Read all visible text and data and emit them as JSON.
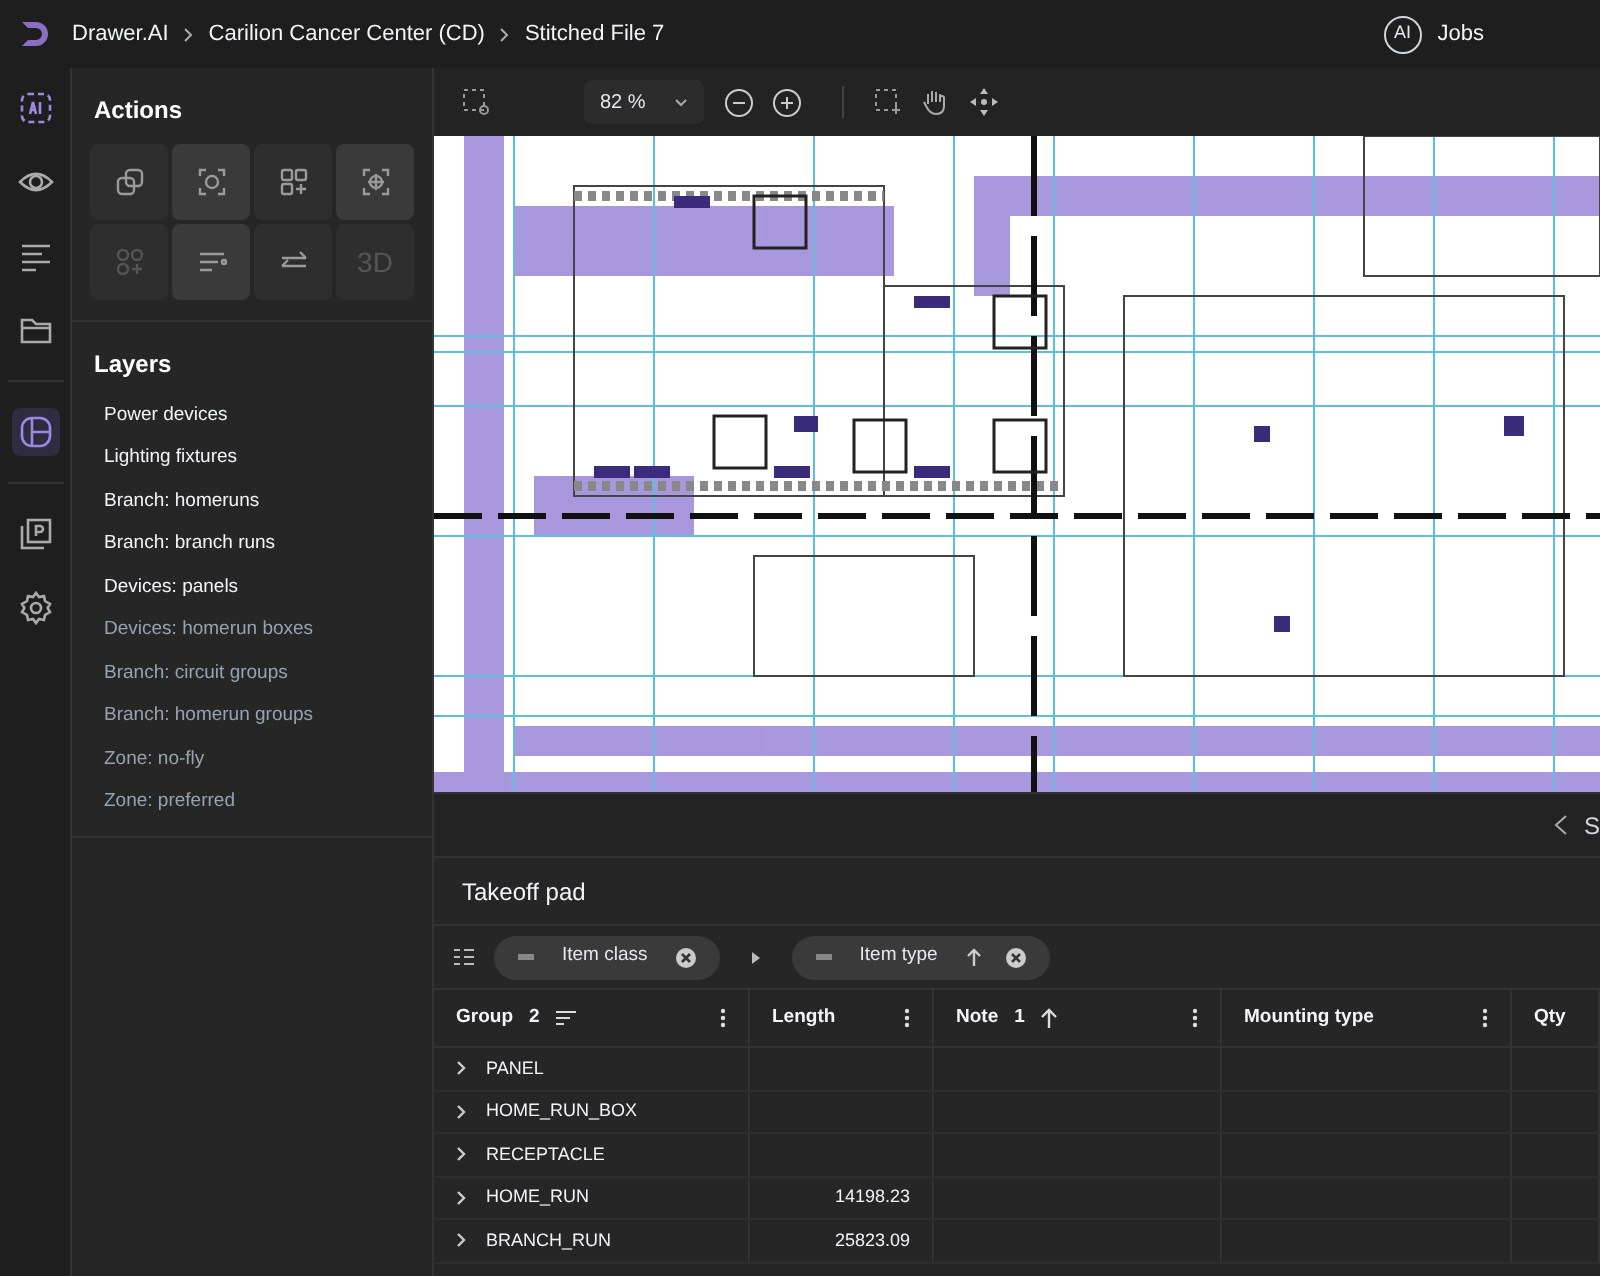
{
  "breadcrumbs": [
    "Drawer.AI",
    "Carilion Cancer Center (CD)",
    "Stitched File 7"
  ],
  "header": {
    "avatar": "AI",
    "jobs": "Jobs"
  },
  "rail": [
    {
      "selected": false
    },
    {
      "selected": false
    },
    {
      "selected": false
    },
    {
      "selected": false
    },
    {
      "selected": true
    },
    {
      "selected": false
    },
    {
      "selected": false
    }
  ],
  "actions": {
    "title": "Actions",
    "tools": [
      {
        "kind": "icon",
        "active": false,
        "enabled": true
      },
      {
        "kind": "icon",
        "active": true,
        "enabled": true
      },
      {
        "kind": "icon",
        "active": false,
        "enabled": true
      },
      {
        "kind": "icon",
        "active": true,
        "enabled": true
      },
      {
        "kind": "icon",
        "active": false,
        "enabled": false
      },
      {
        "kind": "icon",
        "active": true,
        "enabled": true
      },
      {
        "kind": "icon",
        "active": false,
        "enabled": true
      },
      {
        "kind": "text",
        "label": "3D",
        "active": false,
        "enabled": false
      }
    ]
  },
  "layers": {
    "title": "Layers",
    "items": [
      {
        "label": "Power devices",
        "visible": true
      },
      {
        "label": "Lighting fixtures",
        "visible": true
      },
      {
        "label": "Branch: homeruns",
        "visible": true
      },
      {
        "label": "Branch: branch runs",
        "visible": true
      },
      {
        "label": "Devices: panels",
        "visible": true
      },
      {
        "label": "Devices: homerun boxes",
        "visible": false
      },
      {
        "label": "Branch: circuit groups",
        "visible": false
      },
      {
        "label": "Branch: homerun groups",
        "visible": false
      },
      {
        "label": "Zone: no-fly",
        "visible": false
      },
      {
        "label": "Zone: preferred",
        "visible": false
      }
    ]
  },
  "toolbar": {
    "zoom": "82 %"
  },
  "panel_tab": "S",
  "takeoff": {
    "title": "Takeoff pad",
    "groupings": [
      {
        "label": "Item class",
        "sort": false
      },
      {
        "label": "Item type",
        "sort": true
      }
    ],
    "columns": [
      {
        "label": "Group",
        "badge": "2",
        "kind": "lines"
      },
      {
        "label": "Length"
      },
      {
        "label": "Note",
        "badge": "1",
        "kind": "up"
      },
      {
        "label": "Mounting type"
      },
      {
        "label": "Qty"
      }
    ],
    "rows": [
      [
        "PANEL",
        "",
        "",
        "",
        ""
      ],
      [
        "HOME_RUN_BOX",
        "",
        "",
        "",
        ""
      ],
      [
        "RECEPTACLE",
        "",
        "",
        "",
        ""
      ],
      [
        "HOME_RUN",
        "14198.23",
        "",
        "",
        ""
      ],
      [
        "BRANCH_RUN",
        "25823.09",
        "",
        "",
        ""
      ]
    ]
  }
}
